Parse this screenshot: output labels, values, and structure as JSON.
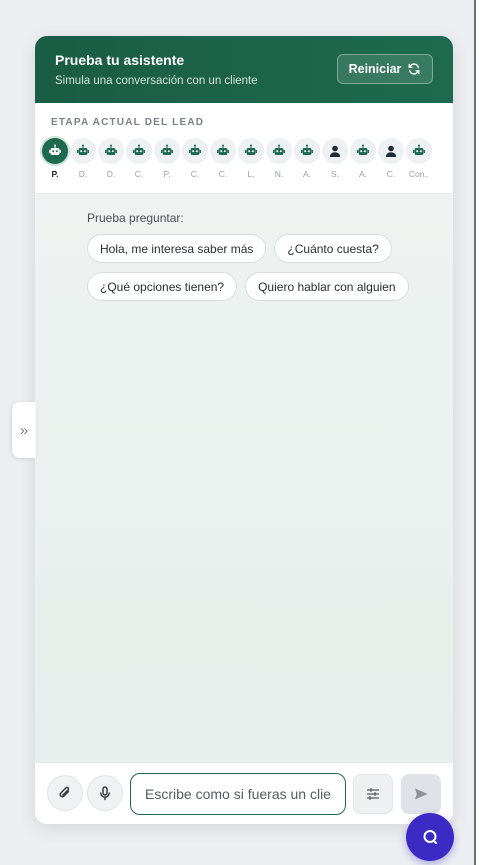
{
  "header": {
    "title": "Prueba tu asistente",
    "subtitle": "Simula una conversación con un cliente",
    "reset_label": "Reiniciar"
  },
  "stage": {
    "label": "ETAPA ACTUAL DEL LEAD",
    "items": [
      {
        "name": "P.",
        "icon": "robot-icon",
        "active": true
      },
      {
        "name": "D.",
        "icon": "robot-icon"
      },
      {
        "name": "D.",
        "icon": "robot-icon"
      },
      {
        "name": "C.",
        "icon": "robot-icon"
      },
      {
        "name": "P.",
        "icon": "robot-icon"
      },
      {
        "name": "C.",
        "icon": "robot-icon"
      },
      {
        "name": "C.",
        "icon": "robot-icon"
      },
      {
        "name": "L.",
        "icon": "robot-icon"
      },
      {
        "name": "N.",
        "icon": "robot-icon"
      },
      {
        "name": "A.",
        "icon": "robot-icon"
      },
      {
        "name": "S.",
        "icon": "person-icon"
      },
      {
        "name": "A.",
        "icon": "robot-icon"
      },
      {
        "name": "C.",
        "icon": "person-icon"
      },
      {
        "name": "Con..",
        "icon": "robot-icon"
      }
    ]
  },
  "suggestions": {
    "label": "Prueba preguntar:",
    "chips": [
      "Hola, me interesa saber más",
      "¿Cuánto cuesta?",
      "¿Qué opciones tienen?",
      "Quiero hablar con alguien"
    ]
  },
  "input": {
    "placeholder": "Escribe como si fueras un cliente..."
  },
  "colors": {
    "brand": "#1e6a4e",
    "fab": "#3b2bc4"
  }
}
